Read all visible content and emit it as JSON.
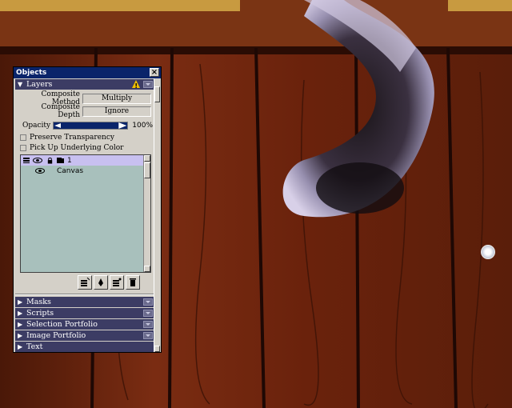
{
  "palette": {
    "title": "Objects",
    "close_glyph": "×",
    "layers": {
      "header": "Layers",
      "composite_method_label": "Composite Method",
      "composite_method_value": "Multiply",
      "composite_depth_label": "Composite Depth",
      "composite_depth_value": "Ignore",
      "opacity_label": "Opacity",
      "opacity_value": "100%",
      "opacity_percent": 100,
      "preserve_transparency": "Preserve Transparency",
      "pick_up_color": "Pick Up Underlying Color",
      "items": [
        {
          "name": "1",
          "selected": true
        },
        {
          "name": "Canvas",
          "selected": false
        }
      ],
      "tools": [
        "new-layer-icon",
        "dynamic-plugins-icon",
        "layer-commands-icon",
        "trash-icon"
      ]
    },
    "sections": [
      {
        "label": "Masks"
      },
      {
        "label": "Scripts"
      },
      {
        "label": "Selection Portfolio"
      },
      {
        "label": "Image Portfolio"
      },
      {
        "label": "Text"
      }
    ]
  },
  "colors": {
    "titlebar": "#0a246a",
    "section_header": "#3c3c64",
    "layer_list_bg": "#a8c0bc",
    "selected_layer": "#c8c0f0",
    "wood": "#6e2410"
  }
}
